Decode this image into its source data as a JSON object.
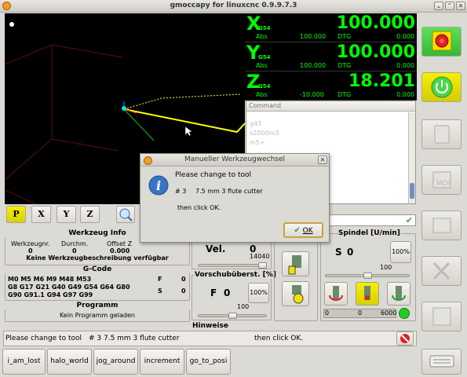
{
  "window": {
    "title": "gmoccapy for linuxcnc 0.9.9.7.3",
    "close_glyph": "✕",
    "min_glyph": "⌄",
    "max_glyph": "⌃"
  },
  "dro": [
    {
      "axis": "X",
      "system": "G54",
      "value": "100.000",
      "abs_label": "Abs",
      "abs_value": "100.000",
      "dtg_label": "DTG",
      "dtg_value": "0.000"
    },
    {
      "axis": "Y",
      "system": "G54",
      "value": "100.000",
      "abs_label": "Abs",
      "abs_value": "100.000",
      "dtg_label": "DTG",
      "dtg_value": "0.000"
    },
    {
      "axis": "Z",
      "system": "G54",
      "value": "18.201",
      "abs_label": "Abs",
      "abs_value": "-10.000",
      "dtg_label": "DTG",
      "dtg_value": "0.000"
    }
  ],
  "mdi": {
    "header": "Command",
    "items": [
      "g43",
      "s2000m3",
      "m5+"
    ]
  },
  "view_buttons": [
    "P",
    "X",
    "Y",
    "Z"
  ],
  "tool_info": {
    "title": "Werkzeug Info",
    "col1_label": "Werkzeugnr.",
    "col1_value": "0",
    "col2_label": "Durchm.",
    "col2_value": "0",
    "col3_label": "Offset Z",
    "col3_value": "0.000",
    "description": "Keine Werkzeugbeschreibung verfügbar"
  },
  "gcode": {
    "title": "G-Code",
    "lines": [
      "M0 M5 M6 M9 M48 M53",
      "G8 G17 G21 G40 G49 G54 G64 G80",
      "G90 G91.1 G94 G97 G99"
    ],
    "f_label": "F",
    "f_value": "0",
    "s_label": "S",
    "s_value": "0"
  },
  "program": {
    "title": "Programm",
    "value": "Kein Programm geladen"
  },
  "velocity": {
    "label": "Vel.",
    "value": "0",
    "max": "14040"
  },
  "feed_override": {
    "title": "Vorschubüberst. [%]",
    "f_label": "F",
    "f_value": "0",
    "reset_label": "100%",
    "slider_value": "100",
    "slider_fraction": 0.5
  },
  "spindle": {
    "title": "Spindel [U/min]",
    "s_label": "S",
    "s_value": "0",
    "reset_label": "100%",
    "override_value": "100",
    "bar_min": "0",
    "bar_value": "0",
    "bar_max": "6000"
  },
  "hints": {
    "title": "Hinweise",
    "message_part1": "Please change to tool",
    "message_part2": "# 3   7.5 mm 3 flute cutter",
    "message_part3": "then click OK."
  },
  "dialog": {
    "title": "Manueller Werkzeugwechsel",
    "line1": "Please change to tool",
    "tool_number": "# 3",
    "tool_desc": "7.5 mm 3 flute cutter",
    "line3": "then click OK.",
    "ok_label": "OK"
  },
  "bottom_buttons": [
    "i_am_lost",
    "halo_world",
    "jog_around",
    "increment",
    "go_to_posi"
  ],
  "colors": {
    "dro_green": "#00ff00",
    "estop_bg": "#4cd64c",
    "toolpath": "#ffff00"
  }
}
